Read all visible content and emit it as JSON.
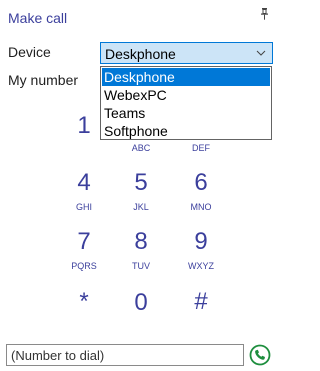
{
  "header": {
    "title": "Make call"
  },
  "device": {
    "label": "Device",
    "selected": "Deskphone",
    "options": [
      "Deskphone",
      "WebexPC",
      "Teams",
      "Softphone"
    ]
  },
  "my_number": {
    "label": "My number"
  },
  "keypad": [
    {
      "digit": "1",
      "letters": ""
    },
    {
      "digit": "2",
      "letters": "ABC"
    },
    {
      "digit": "3",
      "letters": "DEF"
    },
    {
      "digit": "4",
      "letters": "GHI"
    },
    {
      "digit": "5",
      "letters": "JKL"
    },
    {
      "digit": "6",
      "letters": "MNO"
    },
    {
      "digit": "7",
      "letters": "PQRS"
    },
    {
      "digit": "8",
      "letters": "TUV"
    },
    {
      "digit": "9",
      "letters": "WXYZ"
    },
    {
      "digit": "*",
      "letters": ""
    },
    {
      "digit": "0",
      "letters": ""
    },
    {
      "digit": "#",
      "letters": ""
    }
  ],
  "dial": {
    "placeholder": "(Number to dial)"
  },
  "colors": {
    "accent": "#3b3f9c",
    "selection": "#0078d7",
    "call_green": "#1e8e3e"
  }
}
